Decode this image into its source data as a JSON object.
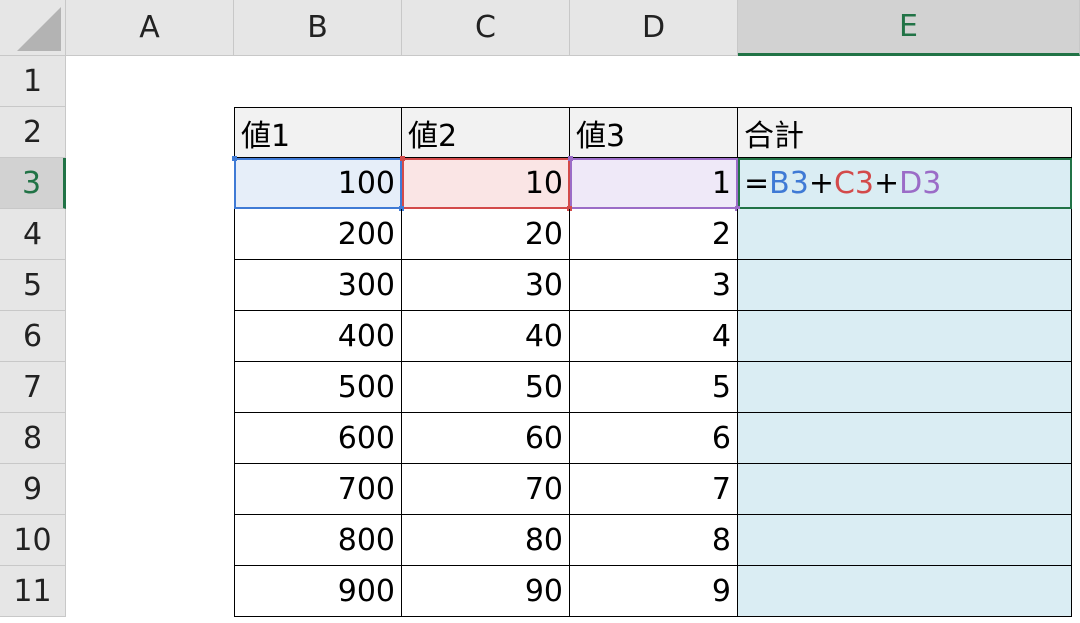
{
  "columns": [
    "A",
    "B",
    "C",
    "D",
    "E"
  ],
  "rows": [
    "1",
    "2",
    "3",
    "4",
    "5",
    "6",
    "7",
    "8",
    "9",
    "10",
    "11"
  ],
  "table": {
    "headers": [
      "値1",
      "値2",
      "値3",
      "合計"
    ],
    "values1": [
      "100",
      "200",
      "300",
      "400",
      "500",
      "600",
      "700",
      "800",
      "900"
    ],
    "values2": [
      "10",
      "20",
      "30",
      "40",
      "50",
      "60",
      "70",
      "80",
      "90"
    ],
    "values3": [
      "1",
      "2",
      "3",
      "4",
      "5",
      "6",
      "7",
      "8",
      "9"
    ]
  },
  "formula": {
    "eq": "=",
    "ref1": "B3",
    "plus1": "+",
    "ref2": "C3",
    "plus2": "+",
    "ref3": "D3"
  },
  "colors": {
    "ref1": "#3f7ad5",
    "ref2": "#d34a4a",
    "ref3": "#9b6cc7",
    "active": "#217346",
    "sum_fill": "#daedf3"
  }
}
